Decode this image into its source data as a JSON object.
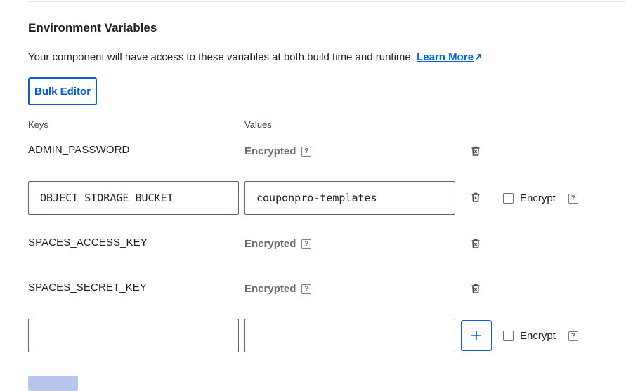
{
  "section": {
    "title": "Environment Variables",
    "description": "Your component will have access to these variables at both build time and runtime.",
    "learn_more": "Learn More"
  },
  "bulk_editor_label": "Bulk Editor",
  "columns": {
    "keys": "Keys",
    "values": "Values"
  },
  "rows": [
    {
      "key": "ADMIN_PASSWORD",
      "value": "Encrypted",
      "help": "?"
    },
    {
      "key": "OBJECT_STORAGE_BUCKET",
      "value": "couponpro-templates",
      "encrypt_label": "Encrypt",
      "encrypt_checked": false,
      "help": "?"
    },
    {
      "key": "SPACES_ACCESS_KEY",
      "value": "Encrypted",
      "help": "?"
    },
    {
      "key": "SPACES_SECRET_KEY",
      "value": "Encrypted",
      "help": "?"
    }
  ],
  "new_row": {
    "key": "",
    "value": "",
    "encrypt_label": "Encrypt",
    "encrypt_checked": false,
    "help": "?"
  },
  "icons": {
    "trash": "trash-icon",
    "external": "external-link-icon",
    "add": "plus-icon",
    "help": "help-icon"
  },
  "colors": {
    "accent": "#0b5ed7",
    "link": "#0061eb",
    "muted": "#676c78",
    "disabled_button": "#b7c6ea"
  }
}
